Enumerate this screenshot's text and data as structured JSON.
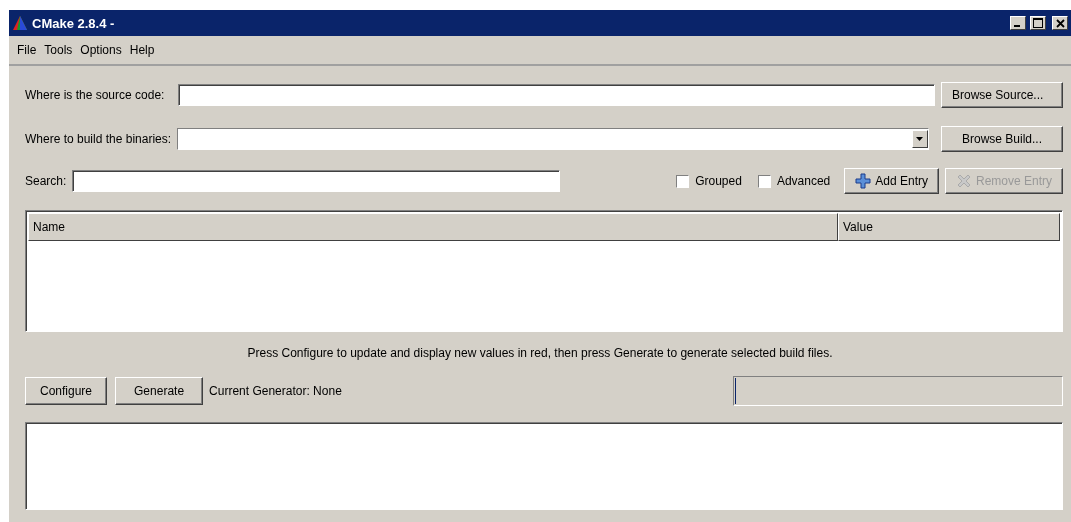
{
  "window": {
    "title": "CMake 2.8.4 -"
  },
  "menu": [
    "File",
    "Tools",
    "Options",
    "Help"
  ],
  "source": {
    "label": "Where is the source code:",
    "button": "Browse Source..."
  },
  "build": {
    "label": "Where to build the binaries:",
    "button": "Browse Build..."
  },
  "search": {
    "label": "Search:"
  },
  "options": [
    {
      "label": "Grouped",
      "checked": false
    },
    {
      "label": "Advanced",
      "checked": false
    }
  ],
  "entry_buttons": [
    {
      "kind": "add",
      "label": "Add Entry",
      "disabled": false
    },
    {
      "kind": "remove",
      "label": "Remove Entry",
      "disabled": true
    }
  ],
  "table": {
    "columns": [
      "Name",
      "Value"
    ]
  },
  "hint": "Press Configure to update and display new values in red, then press Generate to generate selected build files.",
  "actions": [
    "Configure",
    "Generate"
  ],
  "generator": "Current Generator: None",
  "progress": {
    "level": 0
  }
}
